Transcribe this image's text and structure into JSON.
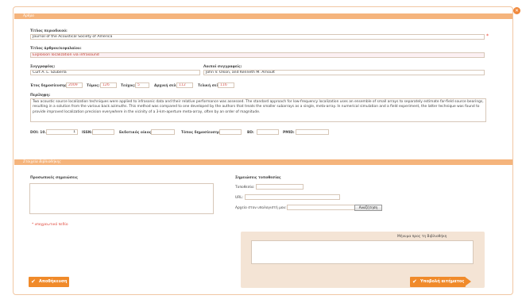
{
  "article": {
    "section_title": "Άρθρο",
    "journal_title_label": "Τίτλος περιοδικού:",
    "journal_title_value": "Journal of the Acoustical Society of America",
    "article_title_label": "Τίτλος άρθρου/κεφαλαίου:",
    "article_title_value": "Explosion localization via infrasound",
    "author_label": "Συγγραφέας:",
    "author_value": "Curt A. L. Szuberla",
    "other_authors_label": "Λοιποί συγγραφείς:",
    "other_authors_value": "John V. Olson, and Kenneth M. Arnoult",
    "year_label": "Έτος δημοσίευσης:",
    "year_value": "2009",
    "volume_label": "Τόμος:",
    "volume_value": "126",
    "issue_label": "Τεύχος:",
    "issue_value": "5",
    "start_page_label": "Αρχική σελ.:",
    "start_page_value": "112",
    "end_page_label": "Τελική σελ.:",
    "end_page_value": "116",
    "abstract_label": "Περίληψη:",
    "abstract_value": "Two acoustic source localization techniques were applied to infrasonic data and their relative performance was assessed. The standard approach for low-frequency localization uses an ensemble of small arrays to separately estimate far-field source bearings, resulting in a solution from the various back azimuths. This method was compared to one developed by the authors that treats the smaller subarrays as a single, meta-array. In numerical simulation and a field experiment, the latter technique was found to provide improved localization precision everywhere in the vicinity of a 3-km-aperture meta-array, often by an order of magnitude.",
    "doi_label": "DOI: 10.",
    "doi_value": "1",
    "issn_label": "ISSN:",
    "issn_value": "",
    "publisher_label": "Εκδοτικός οίκος:",
    "publisher_value": "",
    "pub_place_label": "Τόπος δημοσίευσης:",
    "pub_place_value": "",
    "bd_label": "BD:",
    "bd_value": "",
    "pmid_label": "PMID:",
    "pmid_value": ""
  },
  "library": {
    "section_title": "Στοιχεία Βιβλιοθήκης",
    "personal_notes_label": "Προσωπικές σημειώσεις",
    "location_notes_label": "Σημειώσεις τοποθεσίας",
    "location_label": "Τοποθεσία:",
    "url_label": "URL:",
    "file_label": "Αρχείο στον υπολογιστή μου:",
    "browse_label": "Αναζήτηση",
    "required_note": "* υποχρεωτικό πεδίο",
    "message_label": "Μήνυμα προς τη Βιβλιοθήκη"
  },
  "buttons": {
    "save_label": "Αποθήκευση",
    "submit_label": "Υποβολή αιτήματος"
  },
  "icons": {
    "close": "close-icon",
    "check": "check-icon",
    "arrow": "arrow-right-icon"
  },
  "colors": {
    "accent": "#f08a2a",
    "header": "#f5b47c",
    "panel": "#f4e4d5"
  }
}
